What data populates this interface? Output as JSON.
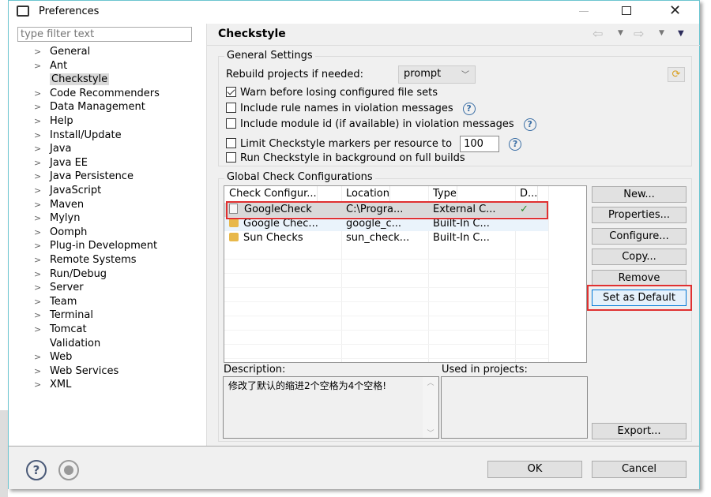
{
  "window": {
    "title": "Preferences",
    "minimize_icon": "minimize-icon",
    "maximize_icon": "maximize-icon",
    "close_icon": "close-icon"
  },
  "filter": {
    "placeholder": "type filter text"
  },
  "tree": [
    {
      "label": "General",
      "expandable": true
    },
    {
      "label": "Ant",
      "expandable": true
    },
    {
      "label": "Checkstyle",
      "expandable": false,
      "selected": true
    },
    {
      "label": "Code Recommenders",
      "expandable": true
    },
    {
      "label": "Data Management",
      "expandable": true
    },
    {
      "label": "Help",
      "expandable": true
    },
    {
      "label": "Install/Update",
      "expandable": true
    },
    {
      "label": "Java",
      "expandable": true
    },
    {
      "label": "Java EE",
      "expandable": true
    },
    {
      "label": "Java Persistence",
      "expandable": true
    },
    {
      "label": "JavaScript",
      "expandable": true
    },
    {
      "label": "Maven",
      "expandable": true
    },
    {
      "label": "Mylyn",
      "expandable": true
    },
    {
      "label": "Oomph",
      "expandable": true
    },
    {
      "label": "Plug-in Development",
      "expandable": true
    },
    {
      "label": "Remote Systems",
      "expandable": true
    },
    {
      "label": "Run/Debug",
      "expandable": true
    },
    {
      "label": "Server",
      "expandable": true
    },
    {
      "label": "Team",
      "expandable": true
    },
    {
      "label": "Terminal",
      "expandable": true
    },
    {
      "label": "Tomcat",
      "expandable": true
    },
    {
      "label": "Validation",
      "expandable": false
    },
    {
      "label": "Web",
      "expandable": true
    },
    {
      "label": "Web Services",
      "expandable": true
    },
    {
      "label": "XML",
      "expandable": true
    }
  ],
  "page": {
    "title": "Checkstyle"
  },
  "general": {
    "title": "General Settings",
    "rebuild_label": "Rebuild projects if needed:",
    "rebuild_value": "prompt",
    "options": [
      {
        "label": "Warn before losing configured file sets",
        "checked": true,
        "help": false
      },
      {
        "label": "Include rule names in violation messages",
        "checked": false,
        "help": true
      },
      {
        "label": "Include module id (if available) in violation messages",
        "checked": false,
        "help": true
      },
      {
        "label": "Limit Checkstyle markers per resource to",
        "checked": false,
        "help": true
      },
      {
        "label": "Run Checkstyle in background on full builds",
        "checked": false,
        "help": false
      }
    ],
    "limit_value": "100"
  },
  "global": {
    "title": "Global Check Configurations",
    "columns": [
      "Check Configur...",
      "Location",
      "Type",
      "D..."
    ],
    "rows": [
      {
        "name": "GoogleCheck",
        "location": "C:\\Progra...",
        "type": "External C...",
        "default": true,
        "icon": "file"
      },
      {
        "name": "Google Chec...",
        "location": "google_c...",
        "type": "Built-In C...",
        "default": false,
        "icon": "lock"
      },
      {
        "name": "Sun Checks",
        "location": "sun_check...",
        "type": "Built-In C...",
        "default": false,
        "icon": "lock"
      }
    ],
    "buttons": [
      "New...",
      "Properties...",
      "Configure...",
      "Copy...",
      "Remove",
      "Set as Default",
      "Export..."
    ],
    "description_label": "Description:",
    "description": "修改了默认的缩进2个空格为4个空格!",
    "used_label": "Used in projects:"
  },
  "footer": {
    "ok": "OK",
    "cancel": "Cancel"
  },
  "colors": {
    "highlight": "#e03030",
    "selected_row": "#d9d9d9",
    "accent": "#0078d7"
  }
}
